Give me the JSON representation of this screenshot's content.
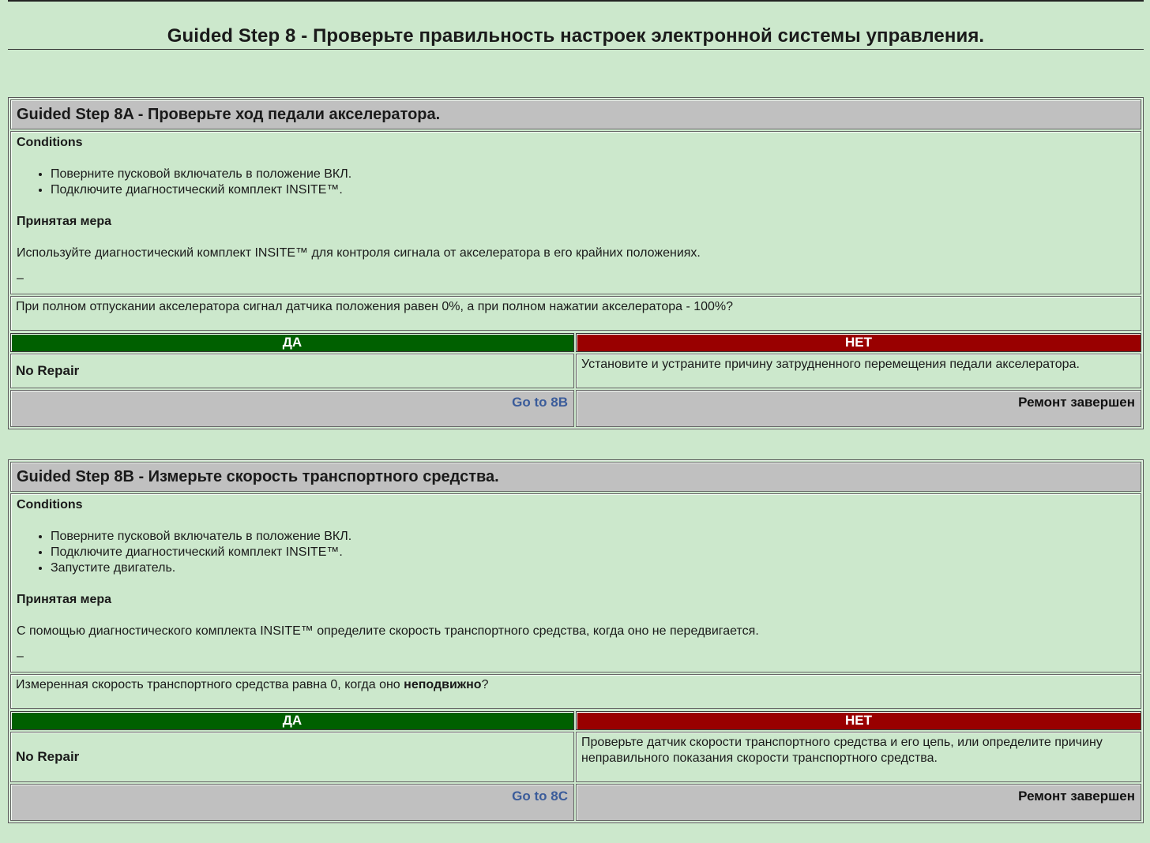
{
  "page": {
    "title": "Guided Step 8 - Проверьте правильность настроек электронной системы управления."
  },
  "steps": [
    {
      "heading": "Guided Step 8A - Проверьте ход педали акселератора.",
      "conditions_title": "Conditions",
      "conditions": [
        "Поверните пусковой включатель в положение ВКЛ.",
        "Подключите диагностический комплект INSITE™."
      ],
      "measure_title": "Принятая мера",
      "action": "Используйте диагностический комплект INSITE™ для контроля сигнала от акселератора в его крайних положениях.",
      "dash": "–",
      "question": "При полном отпускании акселератора сигнал датчика положения равен 0%, а при полном нажатии акселератора - 100%?",
      "yes_label": "ДА",
      "no_label": "НЕТ",
      "yes_text": "No Repair",
      "no_text": "Установите и устраните причину затрудненного перемещения педали акселератора.",
      "goto_link": "Go to 8B",
      "repair_done": "Ремонт завершен"
    },
    {
      "heading": "Guided Step 8B - Измерьте скорость транспортного средства.",
      "conditions_title": "Conditions",
      "conditions": [
        "Поверните пусковой включатель в положение ВКЛ.",
        "Подключите диагностический комплект INSITE™.",
        "Запустите двигатель."
      ],
      "measure_title": "Принятая мера",
      "action": "С помощью диагностического комплекта INSITE™ определите скорость транспортного средства, когда оно не передвигается.",
      "dash": "–",
      "question_pre": "Измеренная скорость транспортного средства равна 0, когда оно ",
      "question_bold": "неподвижно",
      "question_post": "?",
      "yes_label": "ДА",
      "no_label": "НЕТ",
      "yes_text": "No Repair",
      "no_text": "Проверьте датчик скорости транспортного средства и его цепь, или определите причину неправильного показания скорости транспортного средства.",
      "goto_link": "Go to 8C",
      "repair_done": "Ремонт завершен"
    }
  ]
}
